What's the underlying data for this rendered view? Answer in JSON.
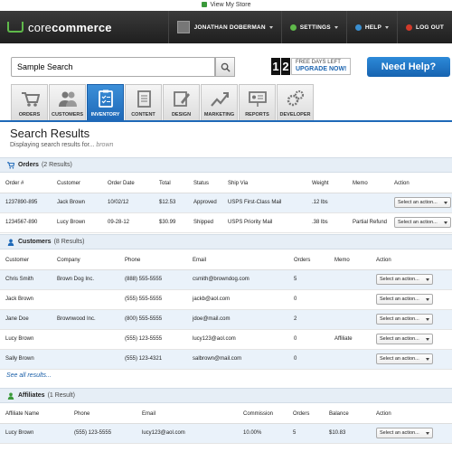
{
  "topbar": {
    "view_store": "View My Store"
  },
  "header": {
    "logo_core": "core",
    "logo_commerce": "commerce",
    "user": "JONATHAN DOBERMAN",
    "settings": "SETTINGS",
    "help": "HELP",
    "logout": "LOG OUT",
    "colors": {
      "accent_green": "#5fb94a",
      "help_blue": "#3a8fd0",
      "logout_red": "#d23a2a"
    }
  },
  "search": {
    "value": "Sample Search"
  },
  "trial": {
    "digit1": "1",
    "digit2": "2",
    "line1": "FREE DAYS LEFT",
    "line2": "UPGRADE NOW!"
  },
  "help_button": "Need Help?",
  "tabs": [
    {
      "label": "ORDERS",
      "icon": "cart-icon"
    },
    {
      "label": "CUSTOMERS",
      "icon": "people-icon"
    },
    {
      "label": "INVENTORY",
      "icon": "clipboard-icon",
      "active": true
    },
    {
      "label": "CONTENT",
      "icon": "document-icon"
    },
    {
      "label": "DESIGN",
      "icon": "design-icon"
    },
    {
      "label": "MARKETING",
      "icon": "chart-arrow-icon"
    },
    {
      "label": "REPORTS",
      "icon": "presentation-icon"
    },
    {
      "label": "DEVELOPER",
      "icon": "gears-icon"
    }
  ],
  "results": {
    "title": "Search Results",
    "subtitle": "Displaying search results for...",
    "query": "brown"
  },
  "orders": {
    "title": "Orders",
    "count": "(2 Results)",
    "columns": [
      "Order #",
      "Customer",
      "Order Date",
      "Total",
      "Status",
      "Ship Via",
      "Weight",
      "Memo",
      "Action"
    ],
    "rows": [
      [
        "1237890-895",
        "Jack Brown",
        "10/02/12",
        "$12.53",
        "Approved",
        "USPS First-Class Mail",
        ".12 lbs",
        "",
        "Select an action..."
      ],
      [
        "1234567-890",
        "Lucy Brown",
        "09-28-12",
        "$30.99",
        "Shipped",
        "USPS Priority Mail",
        ".38 lbs",
        "Partial Refund",
        "Select an action..."
      ]
    ]
  },
  "customers": {
    "title": "Customers",
    "count": "(8 Results)",
    "columns": [
      "Customer",
      "Company",
      "Phone",
      "Email",
      "Orders",
      "Memo",
      "Action"
    ],
    "rows": [
      [
        "Chris Smith",
        "Brown Dog Inc.",
        "(888) 555-5555",
        "csmith@browndog.com",
        "5",
        "",
        "Select an action..."
      ],
      [
        "Jack Brown",
        "",
        "(555) 555-5555",
        "jackb@aol.com",
        "0",
        "",
        "Select an action..."
      ],
      [
        "Jane Doe",
        "Brownwood Inc.",
        "(800) 555-5555",
        "jdoe@mail.com",
        "2",
        "",
        "Select an action..."
      ],
      [
        "Lucy Brown",
        "",
        "(555) 123-5555",
        "lucy123@aol.com",
        "0",
        "Affiliate",
        "Select an action..."
      ],
      [
        "Sally Brown",
        "",
        "(555) 123-4321",
        "salbrown@mail.com",
        "0",
        "",
        "Select an action..."
      ]
    ],
    "see_all": "See all results..."
  },
  "affiliates": {
    "title": "Affiliates",
    "count": "(1 Result)",
    "columns": [
      "Affiliate Name",
      "Phone",
      "Email",
      "Commission",
      "Orders",
      "Balance",
      "Action"
    ],
    "rows": [
      [
        "Lucy Brown",
        "(555) 123-5555",
        "lucy123@aol.com",
        "10.00%",
        "5",
        "$10.83",
        "Select an action..."
      ]
    ]
  }
}
